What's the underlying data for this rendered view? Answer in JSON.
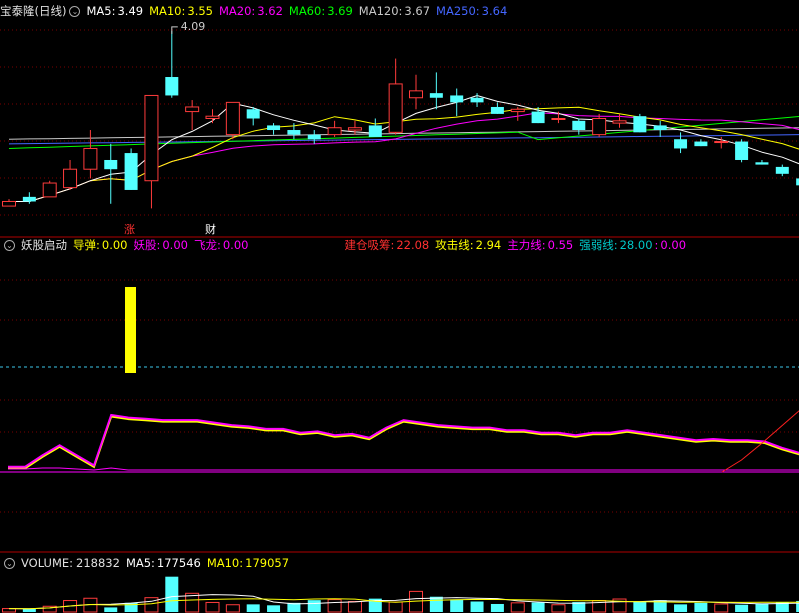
{
  "colors": {
    "up": "#ff3c3c",
    "down": "#54ffff",
    "ma5": "#ffffff",
    "ma10": "#ffff00",
    "ma20": "#ff00ff",
    "ma60": "#00ff00",
    "ma120": "#c8c8c8",
    "ma250": "#4466ff",
    "grid": "#7a0000",
    "dash": "#3bc6e8"
  },
  "main": {
    "title": "宝泰隆(日线)",
    "ma": [
      {
        "label": "MA5:",
        "value": "3.49",
        "color": "#ffffff"
      },
      {
        "label": "MA10:",
        "value": "3.55",
        "color": "#ffff00"
      },
      {
        "label": "MA20:",
        "value": "3.62",
        "color": "#ff00ff"
      },
      {
        "label": "MA60:",
        "value": "3.69",
        "color": "#00ff00"
      },
      {
        "label": "MA120:",
        "value": "3.67",
        "color": "#c8c8c8"
      },
      {
        "label": "MA250:",
        "value": "3.64",
        "color": "#4466ff"
      }
    ],
    "high_marker": "4.09",
    "event_up": "涨",
    "event_fin": "财"
  },
  "indicator": {
    "name": "妖股启动",
    "items": [
      {
        "label": "导弹:",
        "value": "0.00",
        "color": "#ffff00"
      },
      {
        "label": "妖股:",
        "value": "0.00",
        "color": "#ff00ff"
      },
      {
        "label": "飞龙:",
        "value": "0.00",
        "color": "#ff00ff"
      },
      {
        "label": "建仓吸筹:",
        "value": "22.08",
        "color": "#ff3030"
      },
      {
        "label": "攻击线:",
        "value": "2.94",
        "color": "#ffff00"
      },
      {
        "label": "主力线:",
        "value": "0.55",
        "color": "#ff00ff"
      },
      {
        "label": "强弱线:",
        "value": "28.00",
        "color": "#00c8c8"
      },
      {
        "label": ":",
        "value": "0.00",
        "color": "#ff00ff"
      }
    ]
  },
  "volume": {
    "name": "VOLUME:",
    "value": "218832",
    "ma": [
      {
        "label": "MA5:",
        "value": "177546",
        "color": "#ffffff"
      },
      {
        "label": "MA10:",
        "value": "179057",
        "color": "#ffff00"
      }
    ]
  },
  "chart_data": {
    "type": "candlestick",
    "title": "宝泰隆(日线)",
    "price_range": [
      3.3,
      4.12
    ],
    "candles": [
      {
        "o": 3.33,
        "h": 3.36,
        "l": 3.33,
        "c": 3.35
      },
      {
        "o": 3.37,
        "h": 3.39,
        "l": 3.34,
        "c": 3.35
      },
      {
        "o": 3.37,
        "h": 3.44,
        "l": 3.37,
        "c": 3.43
      },
      {
        "o": 3.41,
        "h": 3.53,
        "l": 3.4,
        "c": 3.49
      },
      {
        "o": 3.49,
        "h": 3.66,
        "l": 3.45,
        "c": 3.58
      },
      {
        "o": 3.53,
        "h": 3.6,
        "l": 3.34,
        "c": 3.49
      },
      {
        "o": 3.56,
        "h": 3.58,
        "l": 3.4,
        "c": 3.4
      },
      {
        "o": 3.44,
        "h": 3.81,
        "l": 3.32,
        "c": 3.81
      },
      {
        "o": 3.89,
        "h": 4.09,
        "l": 3.8,
        "c": 3.81
      },
      {
        "o": 3.74,
        "h": 3.79,
        "l": 3.66,
        "c": 3.76
      },
      {
        "o": 3.71,
        "h": 3.75,
        "l": 3.69,
        "c": 3.72
      },
      {
        "o": 3.64,
        "h": 3.78,
        "l": 3.62,
        "c": 3.78
      },
      {
        "o": 3.75,
        "h": 3.76,
        "l": 3.68,
        "c": 3.71
      },
      {
        "o": 3.68,
        "h": 3.69,
        "l": 3.64,
        "c": 3.66
      },
      {
        "o": 3.66,
        "h": 3.69,
        "l": 3.62,
        "c": 3.64
      },
      {
        "o": 3.64,
        "h": 3.66,
        "l": 3.6,
        "c": 3.62
      },
      {
        "o": 3.64,
        "h": 3.7,
        "l": 3.63,
        "c": 3.67
      },
      {
        "o": 3.66,
        "h": 3.7,
        "l": 3.64,
        "c": 3.67
      },
      {
        "o": 3.68,
        "h": 3.71,
        "l": 3.65,
        "c": 3.63
      },
      {
        "o": 3.65,
        "h": 3.97,
        "l": 3.64,
        "c": 3.86
      },
      {
        "o": 3.8,
        "h": 3.9,
        "l": 3.75,
        "c": 3.83
      },
      {
        "o": 3.82,
        "h": 3.91,
        "l": 3.75,
        "c": 3.8
      },
      {
        "o": 3.81,
        "h": 3.84,
        "l": 3.72,
        "c": 3.78
      },
      {
        "o": 3.8,
        "h": 3.82,
        "l": 3.76,
        "c": 3.78
      },
      {
        "o": 3.76,
        "h": 3.78,
        "l": 3.73,
        "c": 3.73
      },
      {
        "o": 3.74,
        "h": 3.76,
        "l": 3.7,
        "c": 3.75
      },
      {
        "o": 3.74,
        "h": 3.76,
        "l": 3.69,
        "c": 3.69
      },
      {
        "o": 3.71,
        "h": 3.74,
        "l": 3.69,
        "c": 3.71
      },
      {
        "o": 3.7,
        "h": 3.71,
        "l": 3.64,
        "c": 3.66
      },
      {
        "o": 3.64,
        "h": 3.73,
        "l": 3.63,
        "c": 3.71
      },
      {
        "o": 3.69,
        "h": 3.73,
        "l": 3.67,
        "c": 3.7
      },
      {
        "o": 3.72,
        "h": 3.73,
        "l": 3.65,
        "c": 3.65
      },
      {
        "o": 3.68,
        "h": 3.7,
        "l": 3.63,
        "c": 3.66
      },
      {
        "o": 3.62,
        "h": 3.65,
        "l": 3.56,
        "c": 3.58
      },
      {
        "o": 3.61,
        "h": 3.62,
        "l": 3.59,
        "c": 3.59
      },
      {
        "o": 3.61,
        "h": 3.63,
        "l": 3.58,
        "c": 3.61
      },
      {
        "o": 3.61,
        "h": 3.62,
        "l": 3.52,
        "c": 3.53
      },
      {
        "o": 3.52,
        "h": 3.53,
        "l": 3.51,
        "c": 3.51
      },
      {
        "o": 3.5,
        "h": 3.51,
        "l": 3.46,
        "c": 3.47
      },
      {
        "o": 3.45,
        "h": 3.46,
        "l": 3.41,
        "c": 3.42
      }
    ],
    "indicator_lines": {
      "attack": [
        5,
        5,
        14,
        22,
        14,
        6,
        46,
        44,
        43,
        42,
        42,
        42,
        40,
        38,
        37,
        35,
        35,
        32,
        33,
        30,
        31,
        28,
        36,
        42,
        40,
        38,
        37,
        36,
        36,
        34,
        34,
        32,
        32,
        30,
        32,
        32,
        34,
        32,
        30,
        28,
        26,
        27,
        26,
        26,
        25,
        20,
        16
      ],
      "main": [
        5,
        5,
        14,
        22,
        14,
        6,
        46,
        44,
        43,
        42,
        42,
        42,
        40,
        38,
        37,
        35,
        35,
        32,
        33,
        30,
        31,
        28,
        36,
        42,
        40,
        38,
        37,
        36,
        36,
        34,
        34,
        32,
        32,
        30,
        32,
        32,
        34,
        32,
        30,
        28,
        26,
        27,
        26,
        26,
        25,
        20,
        16
      ],
      "weak": [
        3,
        3,
        4,
        4,
        3,
        2,
        4,
        2,
        2,
        2,
        2,
        2,
        2,
        2,
        2,
        2,
        2,
        2,
        2,
        2,
        2,
        2,
        2,
        2,
        2,
        2,
        2,
        2,
        2,
        2,
        2,
        2,
        2,
        2,
        2,
        2,
        2,
        2,
        2,
        2,
        2,
        2,
        2,
        2,
        2,
        2,
        2
      ],
      "accumulation_tail": [
        0,
        12,
        28,
        45,
        62
      ]
    },
    "volume_values": [
      18000,
      17000,
      30000,
      60000,
      72000,
      24000,
      48000,
      75000,
      185000,
      98000,
      50000,
      38000,
      40000,
      35000,
      48000,
      62000,
      65000,
      55000,
      70000,
      52000,
      108000,
      80000,
      66000,
      55000,
      42000,
      48000,
      50000,
      38000,
      52000,
      60000,
      68000,
      55000,
      62000,
      40000,
      48000,
      42000,
      38000,
      45000,
      50000,
      58000,
      218832
    ]
  }
}
